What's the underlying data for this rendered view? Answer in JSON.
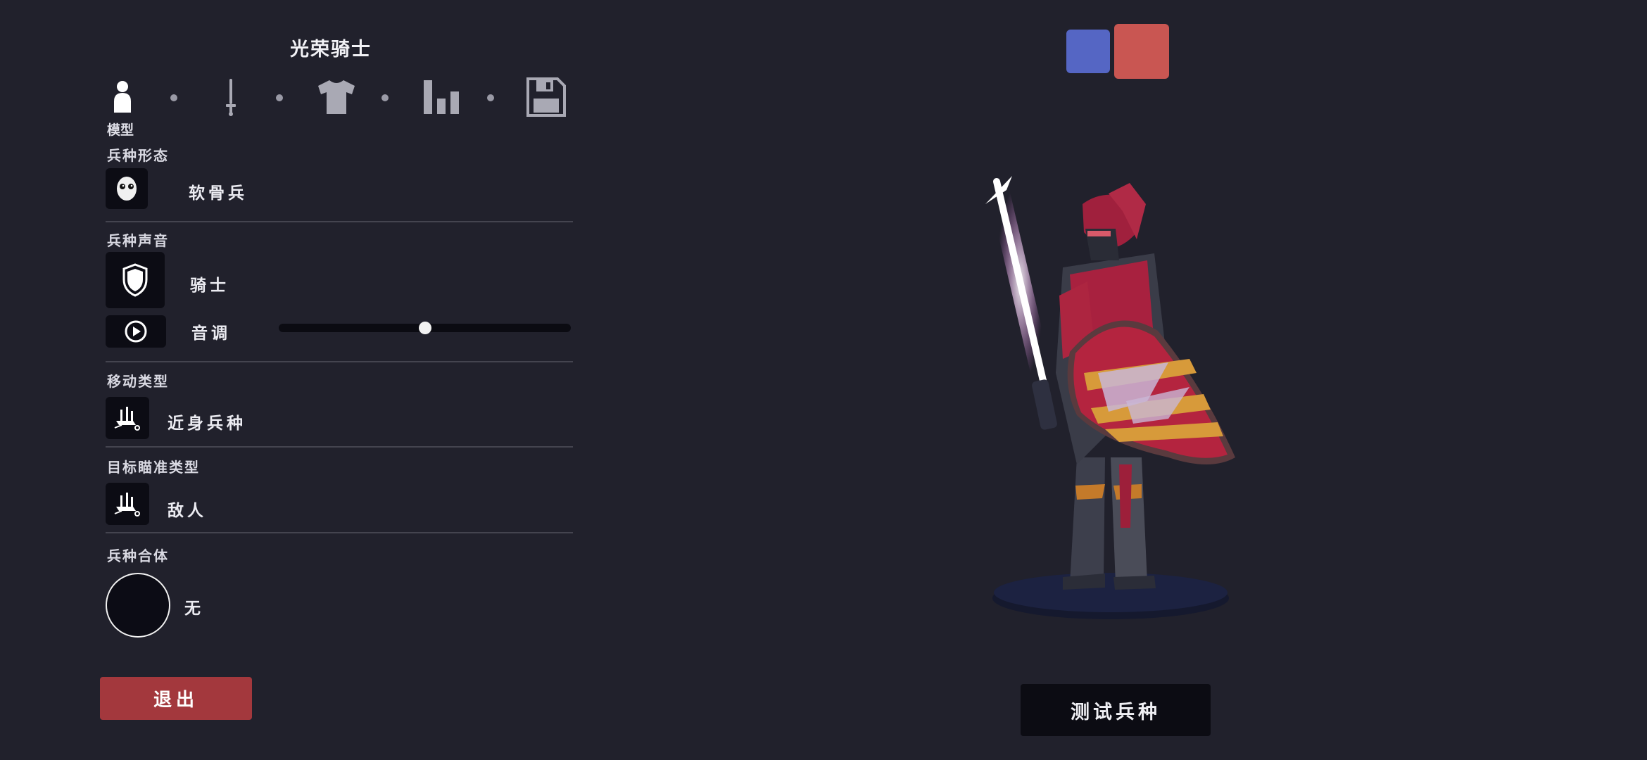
{
  "unit_name": "光荣骑士",
  "tabs": [
    {
      "id": "model",
      "icon": "person-icon",
      "active": true
    },
    {
      "id": "weapons",
      "icon": "sword-icon",
      "active": false
    },
    {
      "id": "clothing",
      "icon": "shirt-icon",
      "active": false
    },
    {
      "id": "stats",
      "icon": "bar-chart-icon",
      "active": false
    },
    {
      "id": "save",
      "icon": "floppy-disk-icon",
      "active": false
    }
  ],
  "active_tab_label": "模型",
  "sections": {
    "unit_form": {
      "label": "兵种形态",
      "value": "软骨兵",
      "icon": "skull-face-icon"
    },
    "unit_voice": {
      "label": "兵种声音",
      "value": "骑士",
      "icon": "shield-icon"
    },
    "pitch": {
      "label": "音调",
      "icon": "play-icon",
      "value": 0.5
    },
    "movement_type": {
      "label": "移动类型",
      "value": "近身兵种",
      "icon": "melee-unit-icon"
    },
    "targeting_type": {
      "label": "目标瞄准类型",
      "value": "敌人",
      "icon": "target-unit-icon"
    },
    "unit_merge": {
      "label": "兵种合体",
      "value": "无",
      "icon": "empty-circle-icon"
    }
  },
  "buttons": {
    "exit": "退出",
    "test_unit": "测试兵种"
  },
  "teams": [
    {
      "name": "blue",
      "color": "#5566c4",
      "selected": false
    },
    {
      "name": "red",
      "color": "#c95652",
      "selected": true
    }
  ]
}
